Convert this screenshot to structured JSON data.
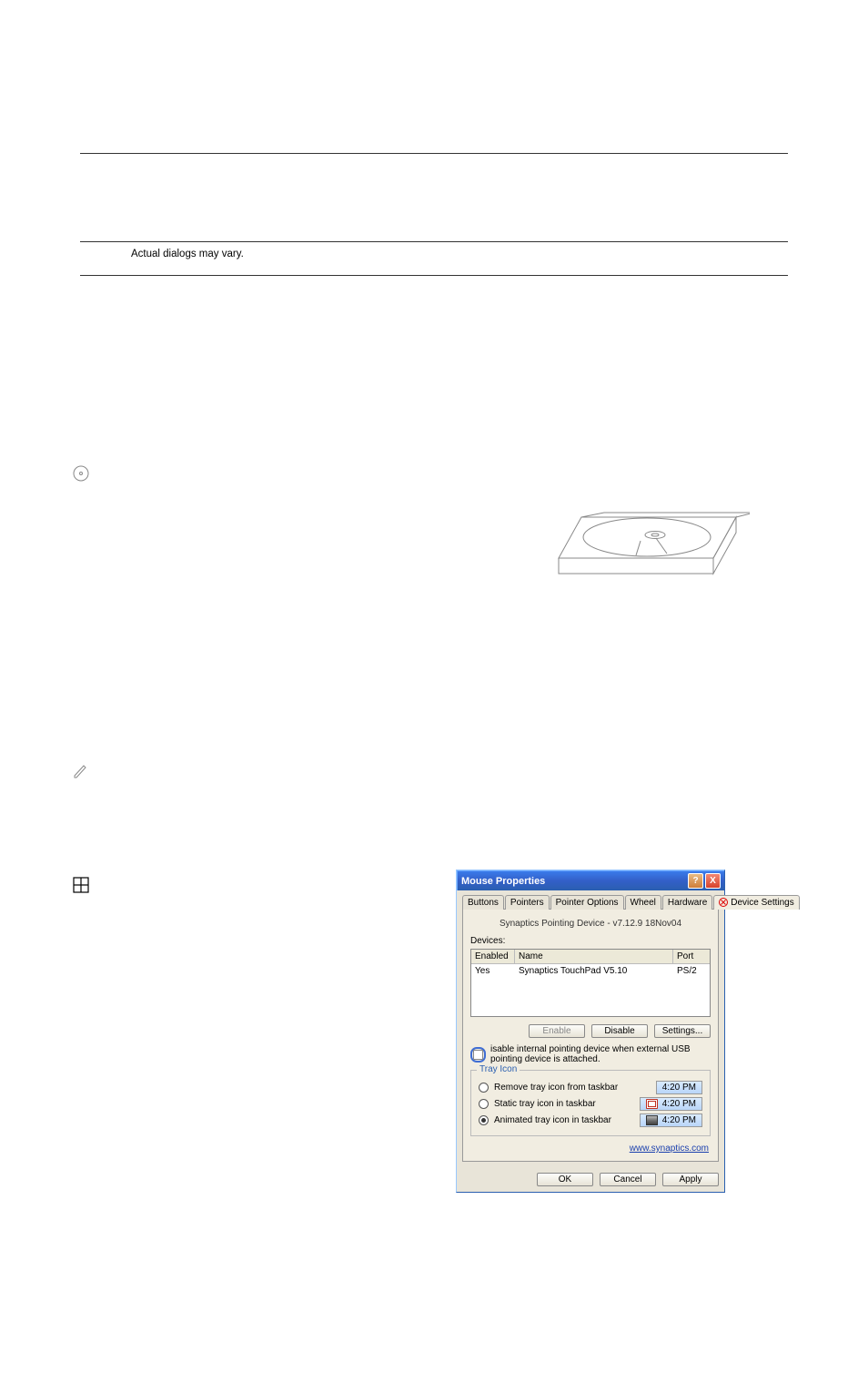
{
  "note": {
    "text": "Actual dialogs may vary."
  },
  "dialog": {
    "title": "Mouse Properties",
    "help_glyph": "?",
    "close_glyph": "X",
    "tabs": {
      "buttons": "Buttons",
      "pointers": "Pointers",
      "pointer_options": "Pointer Options",
      "wheel": "Wheel",
      "hardware": "Hardware",
      "device_settings": "Device Settings"
    },
    "version": "Synaptics Pointing Device - v7.12.9 18Nov04",
    "devices_label": "Devices:",
    "headers": {
      "enabled": "Enabled",
      "name": "Name",
      "port": "Port"
    },
    "devices": [
      {
        "enabled": "Yes",
        "name": "Synaptics TouchPad V5.10",
        "port": "PS/2"
      }
    ],
    "buttons": {
      "enable": "Enable",
      "disable": "Disable",
      "settings": "Settings..."
    },
    "disable_internal": "isable internal pointing device when external USB pointing device is attached.",
    "trayicon": {
      "legend": "Tray Icon",
      "remove": "Remove tray icon from taskbar",
      "static": "Static tray icon in taskbar",
      "animated": "Animated tray icon in taskbar",
      "time": "4:20 PM"
    },
    "link": "www.synaptics.com",
    "ok": "OK",
    "cancel": "Cancel",
    "apply": "Apply"
  }
}
